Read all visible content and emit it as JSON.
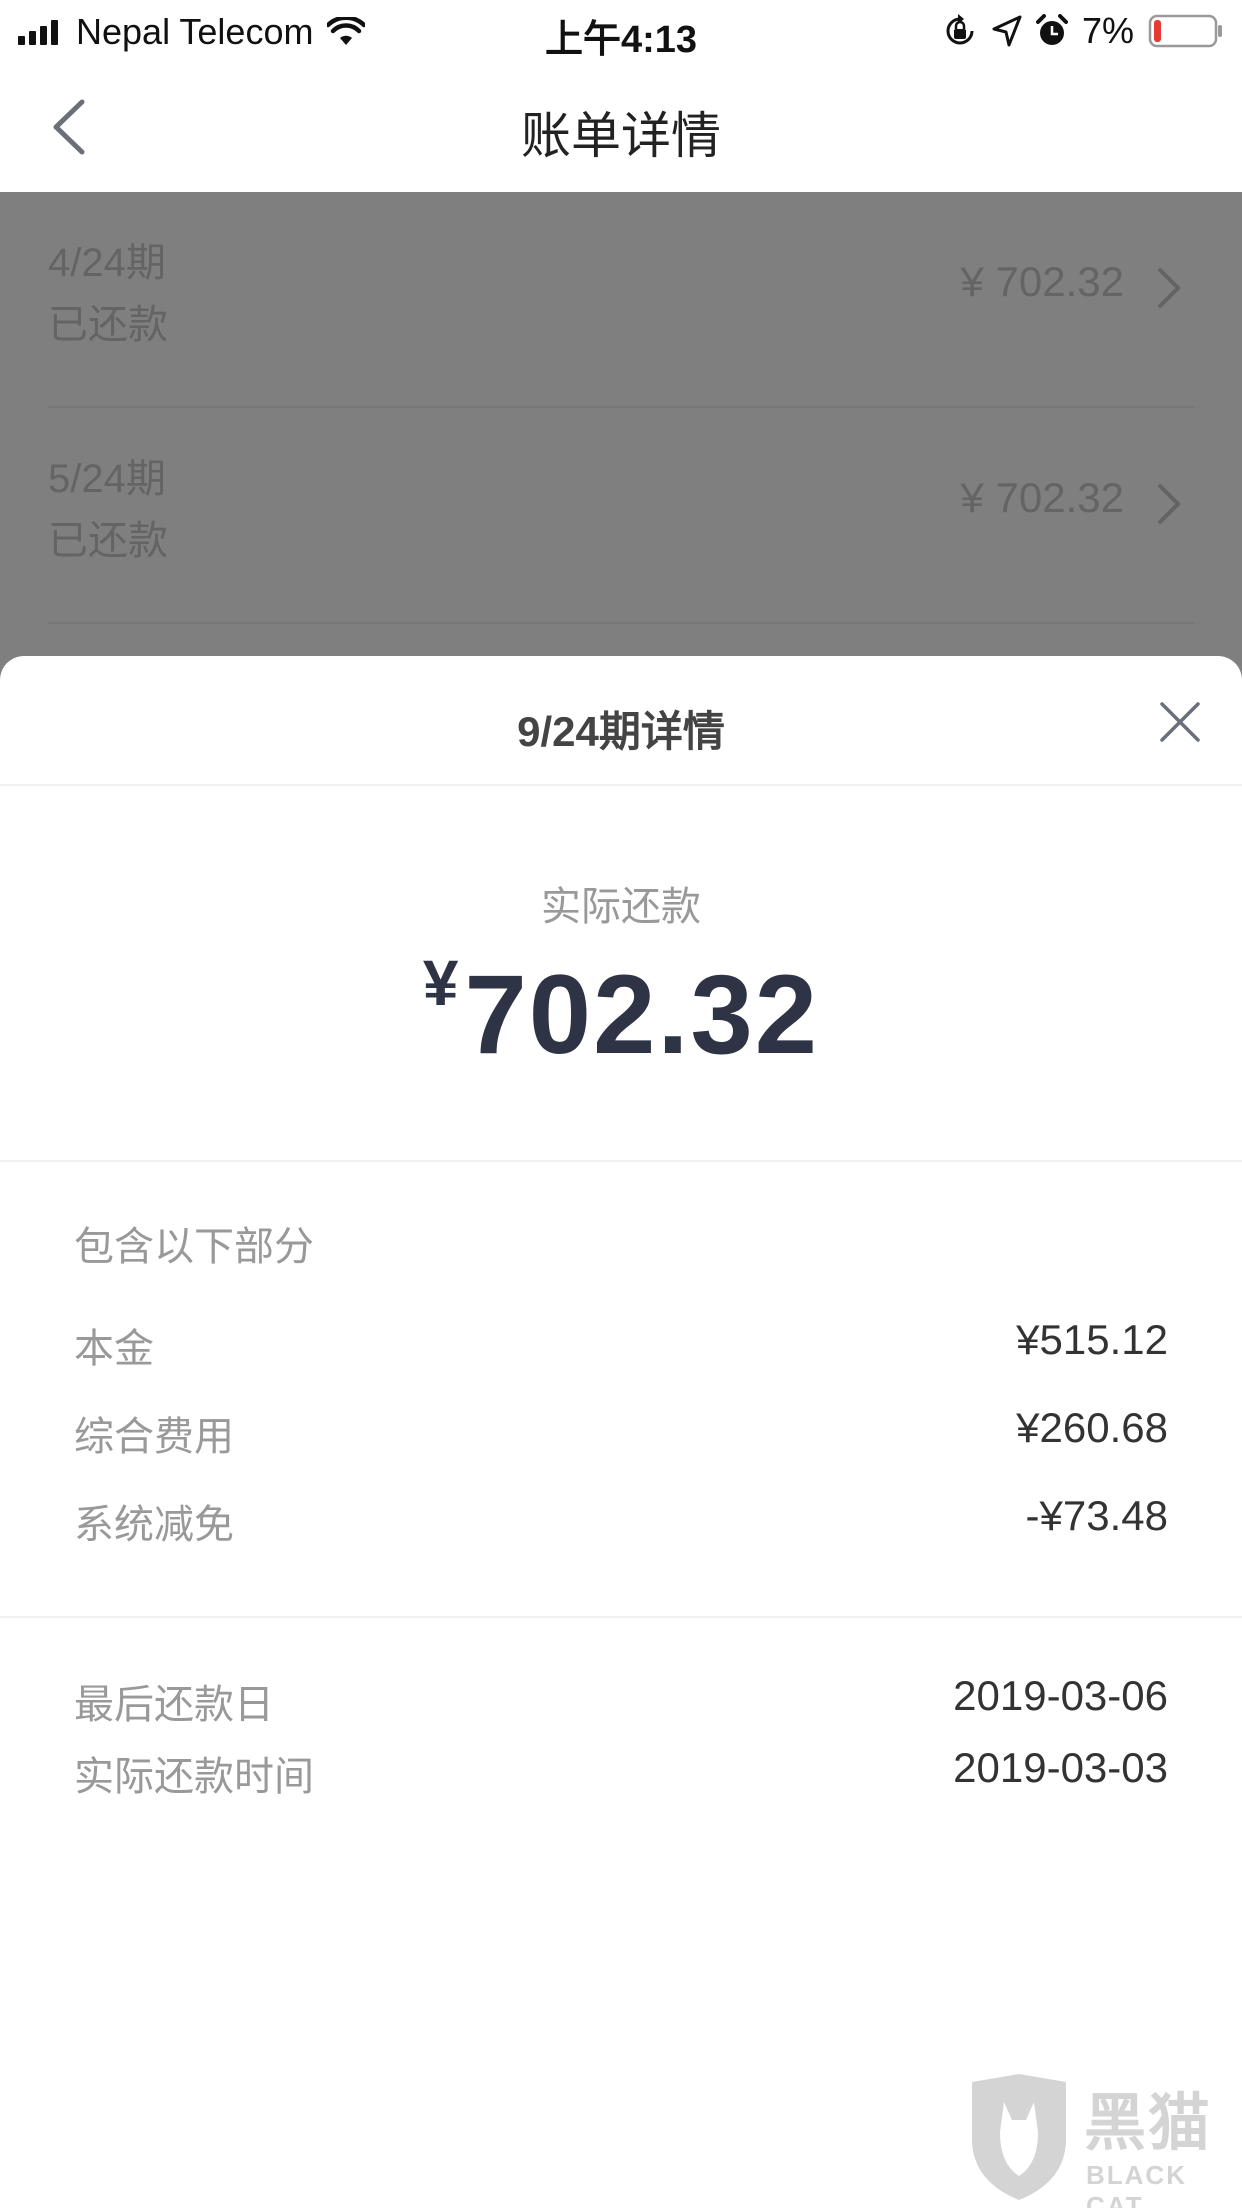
{
  "status_bar": {
    "carrier": "Nepal Telecom",
    "time": "上午4:13",
    "battery": "7%"
  },
  "nav": {
    "title": "账单详情"
  },
  "background_list": [
    {
      "period": "4/24期",
      "status": "已还款",
      "amount": "¥ 702.32"
    },
    {
      "period": "5/24期",
      "status": "已还款",
      "amount": "¥ 702.32"
    }
  ],
  "sheet": {
    "title": "9/24期详情",
    "actual_label": "实际还款",
    "currency": "¥",
    "actual_amount": "702.32",
    "breakdown_title": "包含以下部分",
    "breakdown": [
      {
        "label": "本金",
        "value": "¥515.12"
      },
      {
        "label": "综合费用",
        "value": "¥260.68"
      },
      {
        "label": "系统减免",
        "value": "-¥73.48"
      }
    ],
    "dates": [
      {
        "label": "最后还款日",
        "value": "2019-03-06"
      },
      {
        "label": "实际还款时间",
        "value": "2019-03-03"
      }
    ]
  },
  "watermark": {
    "cn": "黑猫",
    "en": "BLACK CAT"
  },
  "colors": {
    "overlay": "#000000",
    "amount_text": "#2e3445",
    "battery_low": "#e53935"
  },
  "icons": [
    "signal-icon",
    "wifi-icon",
    "rotation-lock-icon",
    "location-icon",
    "alarm-icon",
    "battery-icon",
    "back-arrow-icon",
    "chevron-right-icon",
    "close-icon",
    "cat-shield-icon"
  ]
}
